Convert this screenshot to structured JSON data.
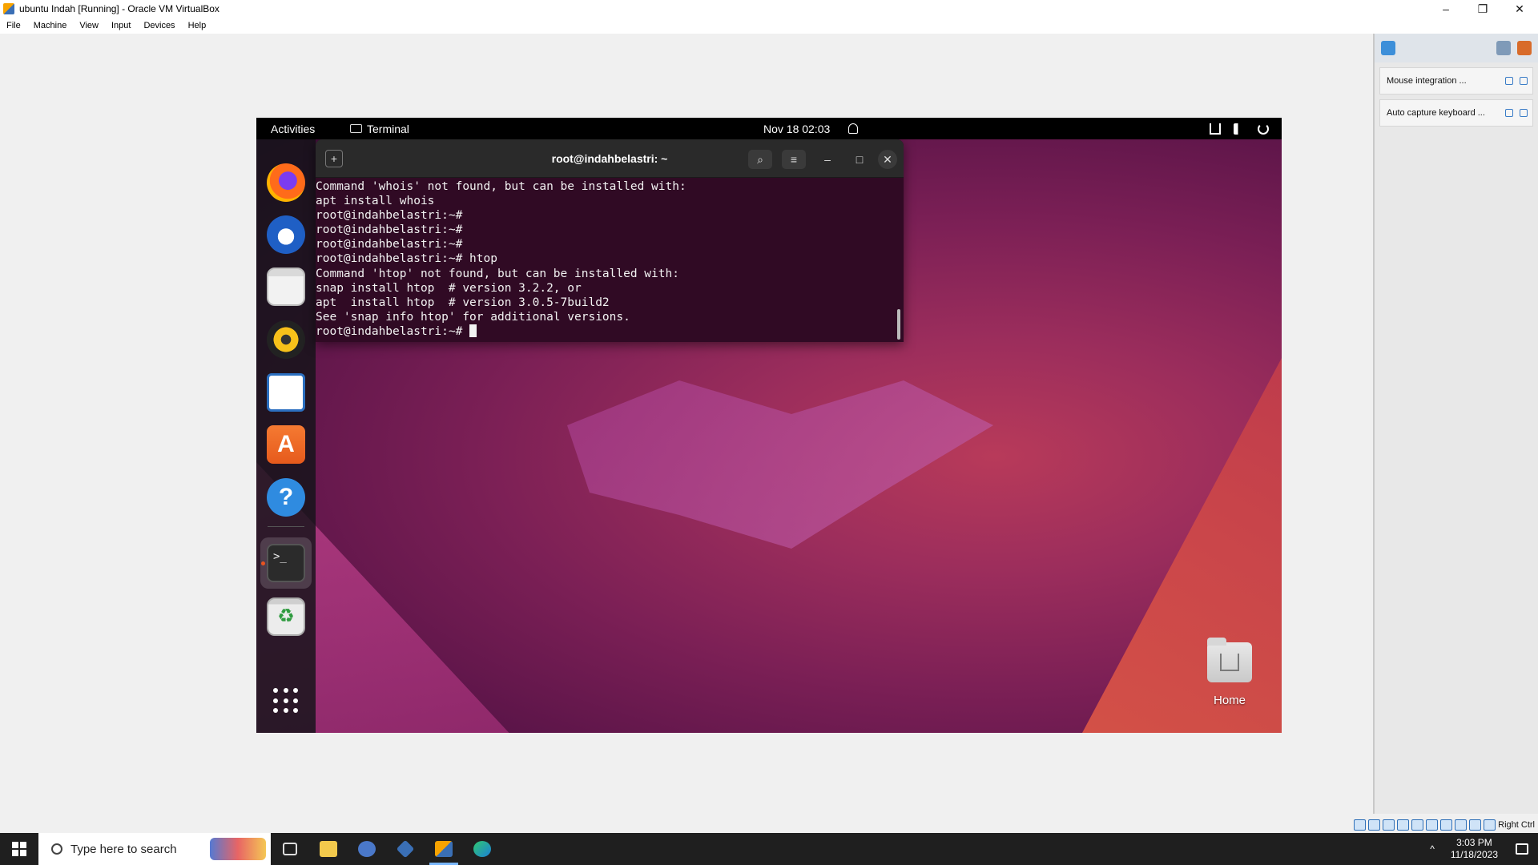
{
  "window": {
    "title": "ubuntu Indah [Running] - Oracle VM VirtualBox",
    "minimize": "–",
    "restore": "❐",
    "close": "✕"
  },
  "menu": [
    "File",
    "Machine",
    "View",
    "Input",
    "Devices",
    "Help"
  ],
  "sidebar": {
    "notifications": [
      "Mouse integration ...",
      "Auto capture keyboard ..."
    ]
  },
  "status_bar": {
    "host_key": "Right Ctrl"
  },
  "guest": {
    "topbar": {
      "activities": "Activities",
      "app_name": "Terminal",
      "clock": "Nov 18  02:03"
    },
    "dock": {
      "store_glyph": "A",
      "help_glyph": "?",
      "terminal_glyph": ">_",
      "trash_glyph": "♻"
    },
    "terminal": {
      "title": "root@indahbelastri: ~",
      "new_tab_glyph": "+",
      "search_glyph": "⌕",
      "menu_glyph": "≡",
      "min_glyph": "–",
      "max_glyph": "□",
      "close_glyph": "✕",
      "lines": [
        "Command 'whois' not found, but can be installed with:",
        "apt install whois",
        "root@indahbelastri:~#",
        "root@indahbelastri:~#",
        "root@indahbelastri:~#",
        "root@indahbelastri:~# htop",
        "Command 'htop' not found, but can be installed with:",
        "snap install htop  # version 3.2.2, or",
        "apt  install htop  # version 3.0.5-7build2",
        "See 'snap info htop' for additional versions."
      ],
      "prompt": "root@indahbelastri:~# "
    },
    "desktop": {
      "home_label": "Home"
    }
  },
  "taskbar": {
    "search_placeholder": "Type here to search",
    "time": "3:03 PM",
    "date": "11/18/2023",
    "tray_chevron": "^"
  }
}
